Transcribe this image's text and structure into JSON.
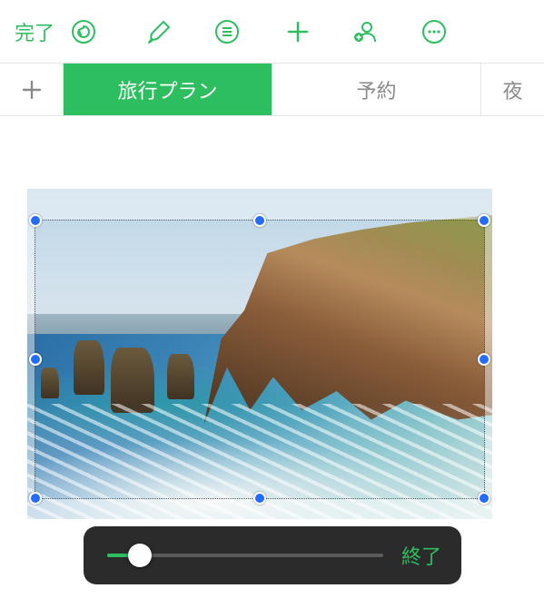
{
  "colors": {
    "accent": "#2dbe60",
    "handle": "#246bff",
    "pill_bg": "#2b2b2b"
  },
  "toolbar": {
    "done_label": "完了"
  },
  "tabs": {
    "active": "旅行プラン",
    "second": "予約",
    "third_partial": "夜"
  },
  "crop": {
    "slider_percent": 12
  },
  "pill": {
    "done_label": "終了"
  }
}
